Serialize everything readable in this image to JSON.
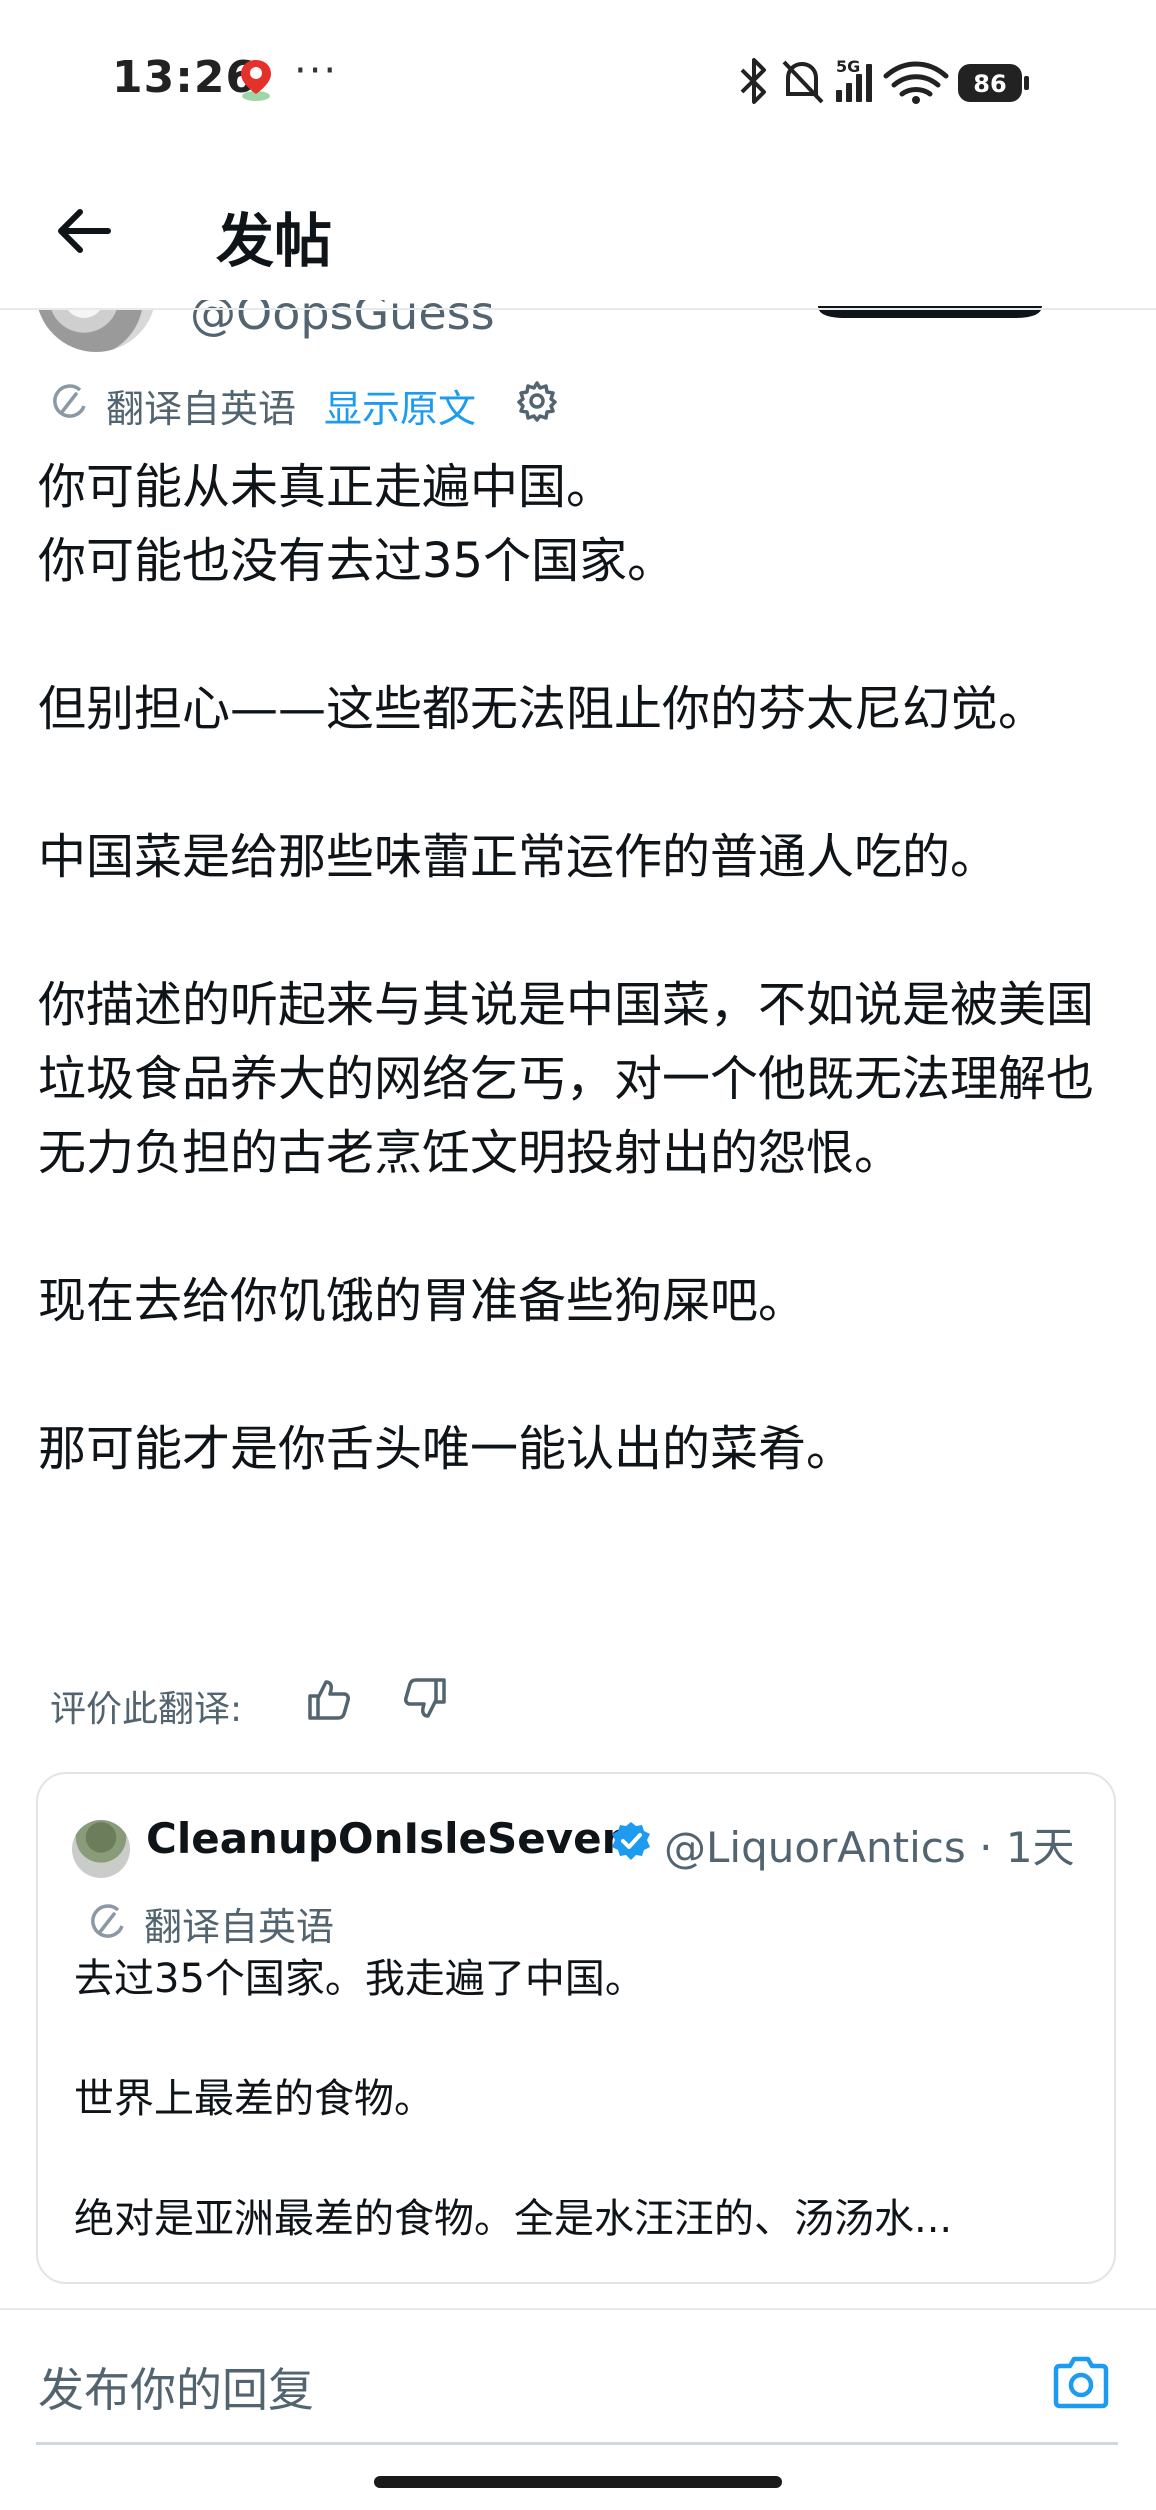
{
  "status_bar": {
    "time": "13:26",
    "more": "···",
    "network": "5G",
    "battery": "86"
  },
  "header": {
    "title": "发帖"
  },
  "author": {
    "handle": "@OopsGuess"
  },
  "translation": {
    "from_label": "翻译自英语",
    "show_original": "显示原文"
  },
  "post": {
    "paragraphs": [
      "你可能从未真正走遍中国。\n你可能也没有去过35个国家。",
      "但别担心——这些都无法阻止你的芬太尼幻觉。",
      "中国菜是给那些味蕾正常运作的普通人吃的。",
      "你描述的听起来与其说是中国菜，不如说是被美国垃圾食品养大的网络乞丐，对一个他既无法理解也无力负担的古老烹饪文明投射出的怨恨。",
      "现在去给你饥饿的胃准备些狗屎吧。",
      "那可能才是你舌头唯一能认出的菜肴。"
    ]
  },
  "rate": {
    "label": "评价此翻译:"
  },
  "quote": {
    "name": "CleanupOnIsleSeven",
    "meta": "@LiquorAntics · 1天",
    "translate_label": "翻译自英语",
    "paragraphs": [
      "去过35个国家。我走遍了中国。",
      "世界上最差的食物。",
      "绝对是亚洲最差的食物。全是水汪汪的、汤汤水..."
    ]
  },
  "reply": {
    "placeholder": "发布你的回复"
  },
  "colors": {
    "accent": "#1d9bf0",
    "secondary_text": "#536471",
    "primary_text": "#0f1419"
  }
}
